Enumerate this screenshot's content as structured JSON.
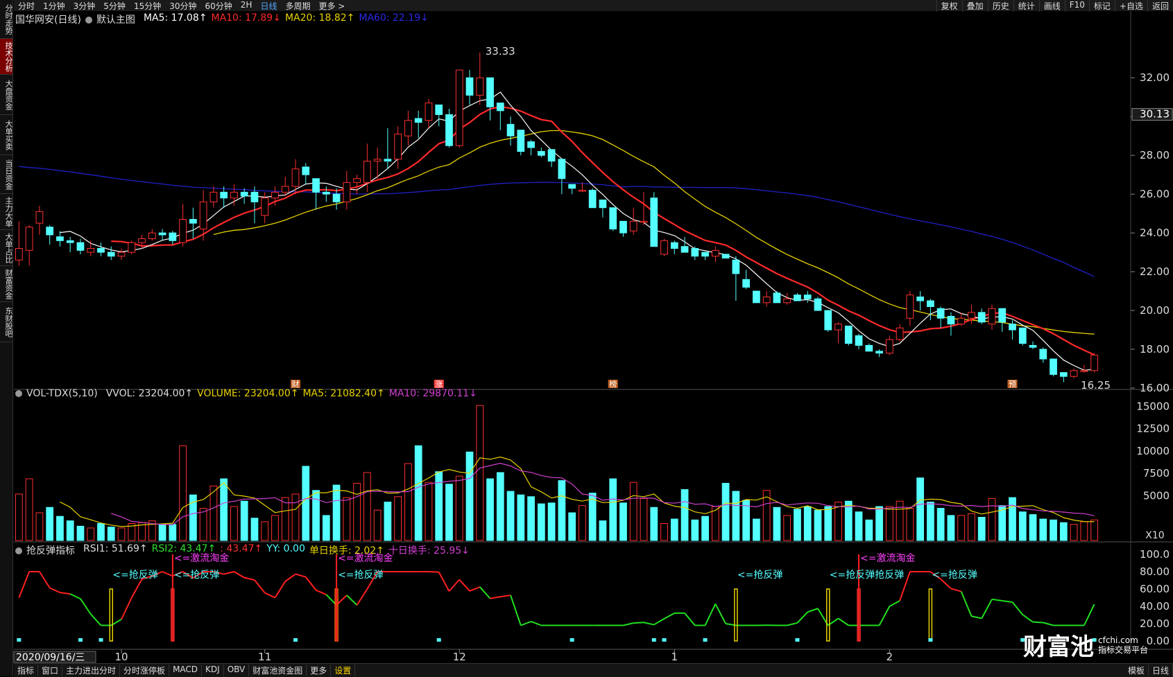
{
  "topbar": {
    "left": [
      "分时",
      "1分钟",
      "3分钟",
      "5分钟",
      "15分钟",
      "30分钟",
      "60分钟",
      "2H",
      "日线",
      "多周期",
      "更多 >"
    ],
    "active_index": 8,
    "right": [
      "复权",
      "叠加",
      "历史",
      "统计",
      "画线",
      "F10",
      "标记",
      "+自选",
      "返回"
    ]
  },
  "sidebar": {
    "items": [
      "分时走势",
      "技术分析",
      "大盘资金",
      "大单买卖",
      "当日资金",
      "主力大单",
      "大单占比",
      "财富资金",
      "东财股吧"
    ],
    "active_index": 1
  },
  "main_legend": {
    "stock": "国华网安(日线)",
    "template": "默认主图",
    "ma5": "MA5: 17.08↑",
    "ma10": "MA10: 17.89↓",
    "ma20": "MA20: 18.82↑",
    "ma60": "MA60: 22.19↓"
  },
  "vol_legend": {
    "name": "VOL-TDX(5,10)",
    "vvol": "VVOL: 23204.00↑",
    "volume": "VOLUME: 23204.00↑",
    "ma5": "MA5: 21082.40↑",
    "ma10": "MA10: 29870.11↓"
  },
  "ind_legend": {
    "name": "抢反弹指标",
    "rsi1": "RSI1: 51.69↑",
    "rsi2": "RSI2: 43.47↑",
    "rsi2b": ": 43.47↑",
    "yy": "YY: 0.00",
    "single": "单日换手: 2.02↑",
    "ten": "十日换手: 25.95↓"
  },
  "price_axis": [
    "32.00",
    "30.00",
    "28.00",
    "26.00",
    "24.00",
    "22.00",
    "20.00",
    "18.00",
    "16.00"
  ],
  "current_price": "30.13",
  "vol_axis": [
    "15000",
    "12500",
    "10000",
    "7500",
    "5000"
  ],
  "vol_unit": "X10",
  "ind_axis": [
    "100.0",
    "80.00",
    "60.00",
    "40.00",
    "20.00",
    "0.00"
  ],
  "date_axis": [
    "10",
    "11",
    "12",
    "1",
    "2"
  ],
  "cursor_date": "2020/09/16/三",
  "high_label": "33.33",
  "low_label": "16.25",
  "event_markers": [
    "财",
    "涨",
    "榜",
    "预"
  ],
  "signals": {
    "rebound": "<=抢反弹",
    "hot": "<=激流淘金",
    "rebound_merged": "<=抢反弹抢反弹"
  },
  "bottombar": {
    "items": [
      "指标",
      "窗口",
      "主力进出分时",
      "分时涨停板",
      "MACD",
      "KDJ",
      "OBV",
      "财富池资金图",
      "更多",
      "设置"
    ],
    "active_index": 9,
    "right": [
      "模板",
      "日线"
    ]
  },
  "watermark": {
    "brand": "财富池",
    "site": "cfchi.com",
    "tagline": "指标交易平台"
  },
  "colors": {
    "up": "#ff3030",
    "down": "#54ffff",
    "ma5": "#ffffff",
    "ma10": "#ff2a2a",
    "ma20": "#e8d200",
    "ma60": "#2020c8",
    "vma5": "#e8d200",
    "vma10": "#d040d0"
  },
  "chart_data": {
    "type": "candlestick",
    "ohlc": [
      [
        22.6,
        23.2,
        22.3,
        24.6
      ],
      [
        23.1,
        24.3,
        22.3,
        24.4
      ],
      [
        24.5,
        25.1,
        23.9,
        25.4
      ],
      [
        24.3,
        23.9,
        23.4,
        24.4
      ],
      [
        23.8,
        23.6,
        23.3,
        24.1
      ],
      [
        23.6,
        23.5,
        23.0,
        23.8
      ],
      [
        23.5,
        23.1,
        22.9,
        23.7
      ],
      [
        23.0,
        23.2,
        22.8,
        23.6
      ],
      [
        23.2,
        23.0,
        22.8,
        23.5
      ],
      [
        23.0,
        22.8,
        22.6,
        23.3
      ],
      [
        22.8,
        23.0,
        22.6,
        23.2
      ],
      [
        23.0,
        23.5,
        22.9,
        23.6
      ],
      [
        23.5,
        23.7,
        23.2,
        23.9
      ],
      [
        23.7,
        24.0,
        23.6,
        24.2
      ],
      [
        24.0,
        23.9,
        23.6,
        24.2
      ],
      [
        24.0,
        23.6,
        23.4,
        24.1
      ],
      [
        23.5,
        24.7,
        23.3,
        25.5
      ],
      [
        24.7,
        24.5,
        23.7,
        25.3
      ],
      [
        24.2,
        25.6,
        23.6,
        26.2
      ],
      [
        25.6,
        26.1,
        25.3,
        26.4
      ],
      [
        26.1,
        25.8,
        25.3,
        26.4
      ],
      [
        25.8,
        26.1,
        25.4,
        26.5
      ],
      [
        26.1,
        25.9,
        25.5,
        26.3
      ],
      [
        26.1,
        25.6,
        24.5,
        26.4
      ],
      [
        24.9,
        25.8,
        24.5,
        26.1
      ],
      [
        25.8,
        26.1,
        25.4,
        26.4
      ],
      [
        26.1,
        26.4,
        25.9,
        26.9
      ],
      [
        26.4,
        27.3,
        26.0,
        27.8
      ],
      [
        27.4,
        27.0,
        26.5,
        27.6
      ],
      [
        26.8,
        26.1,
        25.2,
        26.3
      ],
      [
        26.1,
        26.0,
        25.6,
        26.4
      ],
      [
        26.0,
        25.6,
        25.2,
        26.3
      ],
      [
        25.6,
        26.6,
        25.2,
        27.2
      ],
      [
        26.6,
        26.8,
        26.0,
        27.0
      ],
      [
        26.6,
        27.7,
        26.1,
        28.6
      ],
      [
        27.7,
        27.8,
        26.8,
        28.4
      ],
      [
        27.8,
        27.7,
        27.3,
        29.4
      ],
      [
        27.8,
        29.1,
        27.3,
        29.5
      ],
      [
        29.0,
        29.8,
        28.5,
        30.3
      ],
      [
        29.9,
        29.7,
        28.9,
        30.3
      ],
      [
        29.8,
        30.7,
        29.4,
        30.9
      ],
      [
        30.6,
        30.1,
        29.5,
        30.6
      ],
      [
        30.1,
        28.5,
        28.4,
        30.4
      ],
      [
        28.5,
        32.4,
        28.4,
        32.4
      ],
      [
        32.0,
        31.1,
        30.6,
        32.4
      ],
      [
        31.1,
        32.0,
        30.6,
        33.3
      ],
      [
        32.0,
        30.5,
        29.8,
        32.0
      ],
      [
        30.7,
        30.3,
        29.3,
        30.7
      ],
      [
        29.6,
        29.0,
        28.5,
        30.0
      ],
      [
        29.3,
        28.2,
        28.0,
        29.3
      ],
      [
        28.7,
        28.4,
        28.0,
        28.8
      ],
      [
        28.2,
        28.0,
        27.9,
        28.4
      ],
      [
        28.3,
        27.7,
        27.4,
        28.3
      ],
      [
        27.8,
        26.8,
        26.0,
        27.8
      ],
      [
        26.5,
        26.3,
        26.0,
        26.5
      ],
      [
        26.2,
        26.2,
        26.1,
        26.6
      ],
      [
        26.2,
        25.3,
        25.3,
        26.3
      ],
      [
        25.7,
        25.3,
        24.8,
        25.7
      ],
      [
        25.3,
        24.2,
        24.1,
        25.3
      ],
      [
        24.6,
        24.0,
        23.8,
        24.6
      ],
      [
        24.1,
        24.6,
        23.9,
        25.3
      ],
      [
        24.6,
        24.6,
        24.4,
        26.1
      ],
      [
        25.8,
        23.3,
        23.3,
        26.1
      ],
      [
        22.9,
        23.6,
        22.8,
        23.7
      ],
      [
        23.5,
        23.2,
        22.9,
        23.6
      ],
      [
        23.3,
        23.0,
        23.0,
        23.8
      ],
      [
        23.2,
        22.8,
        22.6,
        23.3
      ],
      [
        23.0,
        22.8,
        22.6,
        23.0
      ],
      [
        22.8,
        23.1,
        22.5,
        23.3
      ],
      [
        22.9,
        22.7,
        22.7,
        22.9
      ],
      [
        22.6,
        21.9,
        20.5,
        22.8
      ],
      [
        21.6,
        21.2,
        21.1,
        22.1
      ],
      [
        21.0,
        20.4,
        20.4,
        21.0
      ],
      [
        20.4,
        20.7,
        20.2,
        21.0
      ],
      [
        20.9,
        20.4,
        20.4,
        21.0
      ],
      [
        20.4,
        20.6,
        20.3,
        20.9
      ],
      [
        20.8,
        20.5,
        20.5,
        20.9
      ],
      [
        20.8,
        20.6,
        20.4,
        21.0
      ],
      [
        20.6,
        20.0,
        20.0,
        20.7
      ],
      [
        20.0,
        19.0,
        18.9,
        20.0
      ],
      [
        19.0,
        19.3,
        18.3,
        19.4
      ],
      [
        19.2,
        18.3,
        18.2,
        19.2
      ],
      [
        18.7,
        18.2,
        18.0,
        18.8
      ],
      [
        18.2,
        17.9,
        17.9,
        18.3
      ],
      [
        17.9,
        17.8,
        17.6,
        18.0
      ],
      [
        17.8,
        18.5,
        17.7,
        18.7
      ],
      [
        18.5,
        19.1,
        18.4,
        19.3
      ],
      [
        19.6,
        20.8,
        19.2,
        21.0
      ],
      [
        20.7,
        20.5,
        20.0,
        21.0
      ],
      [
        20.5,
        20.2,
        19.5,
        20.6
      ],
      [
        20.1,
        19.6,
        19.1,
        20.2
      ],
      [
        19.7,
        19.3,
        18.7,
        19.9
      ],
      [
        19.3,
        19.6,
        19.2,
        19.9
      ],
      [
        19.6,
        19.9,
        19.3,
        20.3
      ],
      [
        19.9,
        19.4,
        19.3,
        20.1
      ],
      [
        19.3,
        20.1,
        19.0,
        20.3
      ],
      [
        20.1,
        19.4,
        18.9,
        20.1
      ],
      [
        19.3,
        19.0,
        18.5,
        19.5
      ],
      [
        19.1,
        18.3,
        18.2,
        19.1
      ],
      [
        18.2,
        18.1,
        18.0,
        18.4
      ],
      [
        18.0,
        17.5,
        17.3,
        18.1
      ],
      [
        17.5,
        16.7,
        16.6,
        17.5
      ],
      [
        16.8,
        16.6,
        16.3,
        16.8
      ],
      [
        16.6,
        16.9,
        16.5,
        17.0
      ],
      [
        16.9,
        16.9,
        16.8,
        17.2
      ],
      [
        16.9,
        17.7,
        16.8,
        17.8
      ]
    ],
    "volume": [
      5200,
      6900,
      3100,
      3700,
      2700,
      2200,
      1600,
      1400,
      1900,
      1500,
      1400,
      1900,
      2000,
      2200,
      1800,
      1800,
      10600,
      5100,
      3600,
      6100,
      6900,
      3800,
      4400,
      2500,
      2100,
      2800,
      4800,
      5200,
      8300,
      5600,
      2800,
      6200,
      4800,
      6400,
      7600,
      3400,
      4300,
      4900,
      8600,
      10600,
      6500,
      7700,
      6300,
      7200,
      9900,
      15100,
      6900,
      7600,
      5500,
      5100,
      4900,
      4100,
      4200,
      6700,
      3100,
      3900,
      5300,
      2200,
      6900,
      4200,
      6500,
      4700,
      3700,
      1900,
      2400,
      5700,
      2300,
      2700,
      3800,
      6400,
      5500,
      4500,
      2400,
      5600,
      3700,
      2800,
      3500,
      3800,
      3400,
      3800,
      4300,
      4400,
      3200,
      2300,
      3800,
      3800,
      4400,
      3600,
      7000,
      4300,
      3600,
      2800,
      2800,
      3000,
      2600,
      4700,
      3900,
      4800,
      3200,
      2900,
      2400,
      2300,
      2000,
      1800,
      2100,
      2300
    ],
    "ma5": [
      17.08
    ],
    "ylim": [
      16.0,
      33.33
    ]
  }
}
